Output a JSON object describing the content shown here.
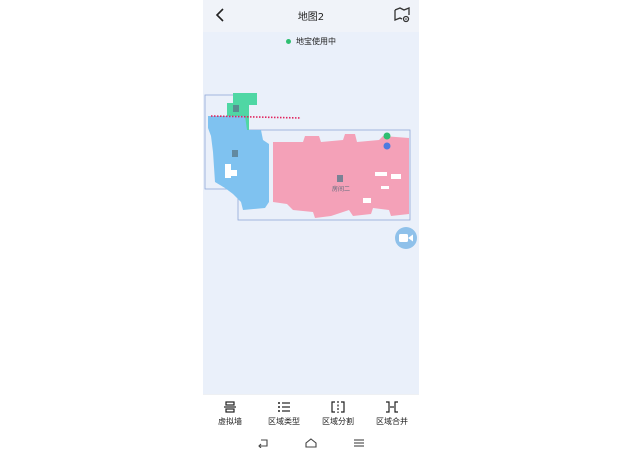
{
  "header": {
    "title": "地图2",
    "back_icon": "chevron-left-icon",
    "settings_icon": "map-settings-icon"
  },
  "status": {
    "text": "地宝使用中",
    "dot_color": "#2fbf71"
  },
  "map": {
    "rooms": [
      {
        "name": "",
        "color": "#4fd7a4"
      },
      {
        "name": "",
        "color": "#7fc2f0"
      },
      {
        "name": "房间二",
        "color": "#f4a1b8"
      }
    ],
    "outline_color": "#8fa8d8",
    "virtual_wall_color": "#e0245e",
    "robot_color": "#2fbf71",
    "dock_color": "#4d7be0"
  },
  "video_button": {
    "icon": "video-camera-icon"
  },
  "toolbar": {
    "items": [
      {
        "label": "虚拟墙",
        "icon": "virtual-wall-icon"
      },
      {
        "label": "区域类型",
        "icon": "list-icon"
      },
      {
        "label": "区域分割",
        "icon": "split-icon"
      },
      {
        "label": "区域合并",
        "icon": "merge-icon"
      }
    ]
  },
  "navbar": {
    "back_icon": "nav-back-icon",
    "home_icon": "nav-home-icon",
    "menu_icon": "nav-menu-icon"
  }
}
